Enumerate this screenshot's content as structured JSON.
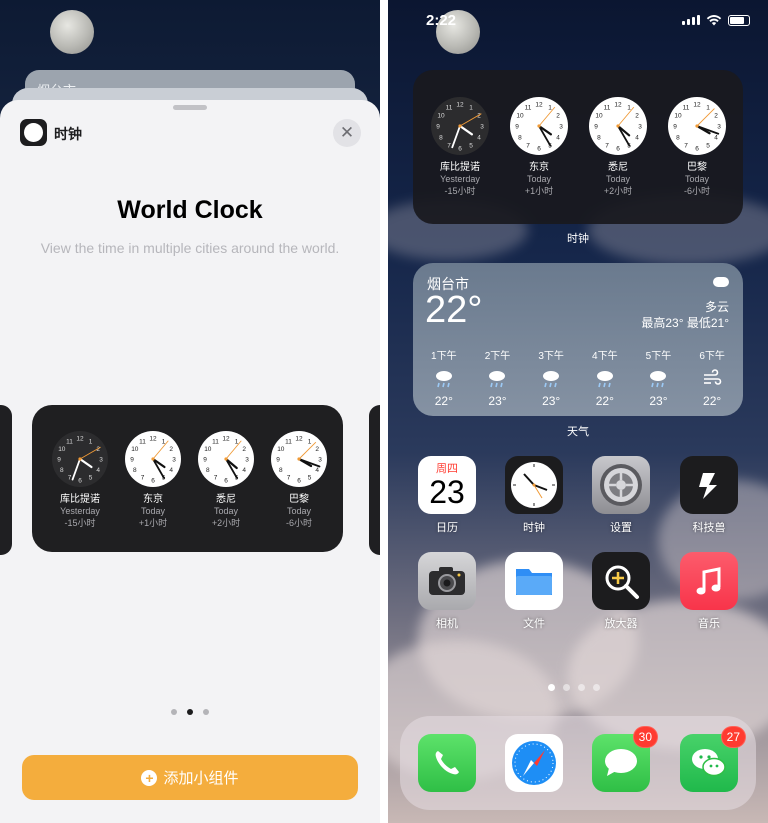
{
  "left": {
    "behind_card_label": "烟台市",
    "app_name": "时钟",
    "widget_title": "World Clock",
    "widget_description": "View the time in multiple cities around the world.",
    "page_dots": [
      false,
      true,
      false
    ],
    "add_button_label": "添加小组件",
    "clocks": [
      {
        "city": "库比提诺",
        "day": "Yesterday",
        "offset": "-15小时",
        "dark": true
      },
      {
        "city": "东京",
        "day": "Today",
        "offset": "+1小时",
        "dark": false
      },
      {
        "city": "悉尼",
        "day": "Today",
        "offset": "+2小时",
        "dark": false
      },
      {
        "city": "巴黎",
        "day": "Today",
        "offset": "-6小时",
        "dark": false
      }
    ]
  },
  "right": {
    "status_time": "2:22",
    "clock_widget_label": "时钟",
    "clocks": [
      {
        "city": "库比提诺",
        "day": "Yesterday",
        "offset": "-15小时",
        "dark": true
      },
      {
        "city": "东京",
        "day": "Today",
        "offset": "+1小时",
        "dark": false
      },
      {
        "city": "悉尼",
        "day": "Today",
        "offset": "+2小时",
        "dark": false
      },
      {
        "city": "巴黎",
        "day": "Today",
        "offset": "-6小时",
        "dark": false
      }
    ],
    "weather": {
      "city": "烟台市",
      "temp": "22°",
      "condition": "多云",
      "high_low": "最高23° 最低21°",
      "label": "天气",
      "hours": [
        {
          "time": "1下午",
          "temp": "22°",
          "icon": "rain-icon"
        },
        {
          "time": "2下午",
          "temp": "23°",
          "icon": "rain-icon"
        },
        {
          "time": "3下午",
          "temp": "23°",
          "icon": "rain-icon"
        },
        {
          "time": "4下午",
          "temp": "22°",
          "icon": "rain-icon"
        },
        {
          "time": "5下午",
          "temp": "23°",
          "icon": "rain-icon"
        },
        {
          "time": "6下午",
          "temp": "22°",
          "icon": "wind-icon"
        }
      ]
    },
    "calendar": {
      "weekday": "周四",
      "day": "23"
    },
    "apps": [
      {
        "label": "日历",
        "icon": "calendar-icon"
      },
      {
        "label": "时钟",
        "icon": "clock-icon"
      },
      {
        "label": "设置",
        "icon": "settings-gear-icon"
      },
      {
        "label": "科技兽",
        "icon": "kejishou-icon"
      },
      {
        "label": "相机",
        "icon": "camera-icon"
      },
      {
        "label": "文件",
        "icon": "folder-icon"
      },
      {
        "label": "放大器",
        "icon": "magnifier-icon"
      },
      {
        "label": "音乐",
        "icon": "music-note-icon"
      }
    ],
    "page_dots": [
      true,
      false,
      false,
      false
    ],
    "dock": [
      {
        "icon": "phone-icon",
        "badge": ""
      },
      {
        "icon": "safari-compass-icon",
        "badge": ""
      },
      {
        "icon": "messages-icon",
        "badge": "30"
      },
      {
        "icon": "wechat-icon",
        "badge": "27"
      }
    ],
    "colors": {
      "accent_orange": "#f4ad3d",
      "badge_red": "#ff3b30",
      "clock_second_hand": "#f09a36"
    }
  }
}
